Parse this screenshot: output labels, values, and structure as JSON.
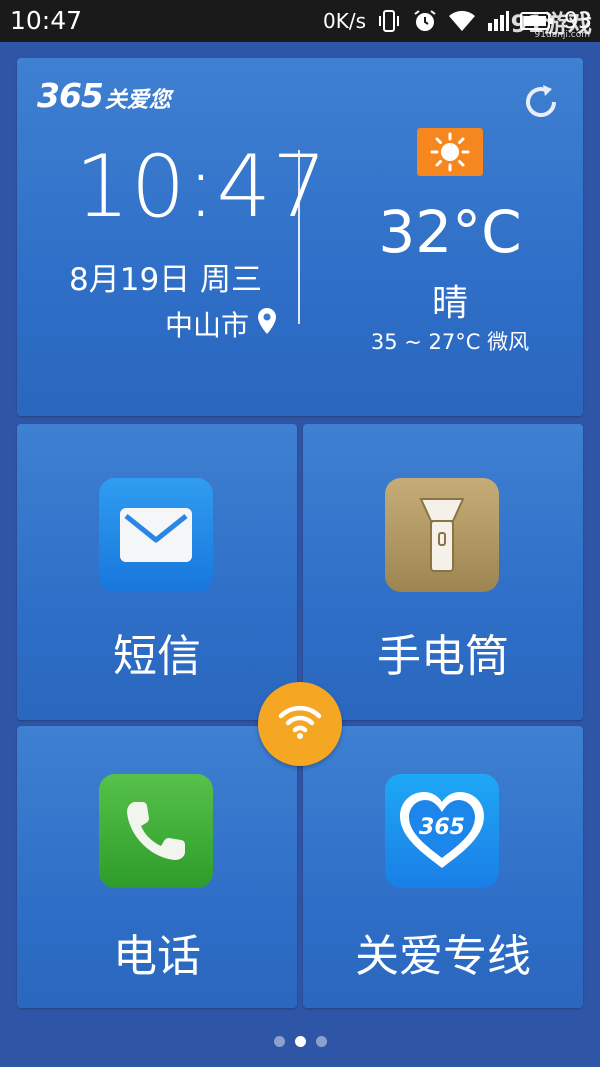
{
  "statusbar": {
    "time": "10:47",
    "net_speed": "0K/s",
    "battery": "93",
    "icons": [
      "vibrate-icon",
      "alarm-icon",
      "wifi-icon",
      "signal-icon",
      "battery-icon"
    ],
    "watermark_main": "91游戏",
    "watermark_sub": "91danji.com"
  },
  "header": {
    "logo_number": "365",
    "logo_text": "关爱您",
    "refresh_icon": "refresh-icon"
  },
  "clock": {
    "time": "10:47",
    "date": "8月19日 周三",
    "city": "中山市"
  },
  "weather": {
    "icon": "sun-icon",
    "temperature": "32°C",
    "condition": "晴",
    "range": "35 ~ 27°C 微风"
  },
  "tiles": [
    {
      "label": "短信",
      "icon": "envelope-icon"
    },
    {
      "label": "手电筒",
      "icon": "flashlight-icon"
    },
    {
      "label": "电话",
      "icon": "phone-icon"
    },
    {
      "label": "关爱专线",
      "icon": "heart-365-icon",
      "icon_text": "365"
    }
  ],
  "colors": {
    "background": "#2f55a6",
    "tile": "#3a7bd0",
    "weather_badge": "#f6871e",
    "wifi_button": "#f5a623"
  },
  "pager": {
    "count": 3,
    "active_index": 1
  }
}
